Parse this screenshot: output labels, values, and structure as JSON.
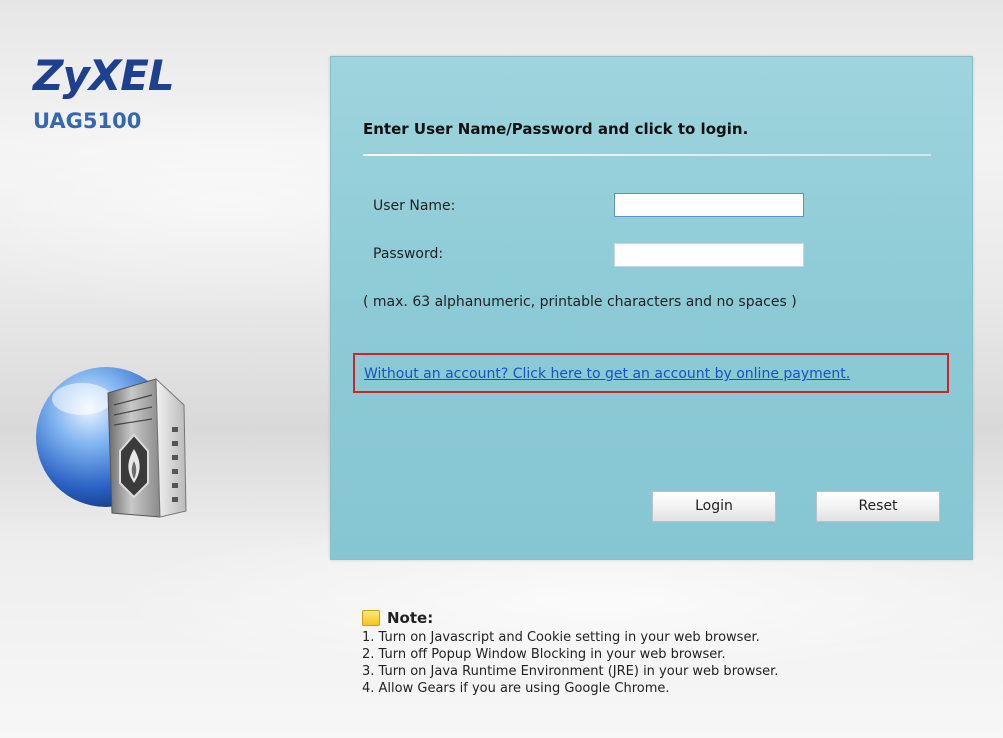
{
  "brand": {
    "logo": "ZyXEL",
    "model": "UAG5100"
  },
  "icons": {
    "product": "globe-firewall-icon",
    "note": "note-icon"
  },
  "colors": {
    "panel": "#8ccbd6",
    "brand": "#1f3f8f",
    "link": "#1a52c4",
    "highlight": "#d0242a"
  },
  "login": {
    "title": "Enter User Name/Password and click to login.",
    "username_label": "User Name:",
    "username_value": "",
    "password_label": "Password:",
    "password_value": "",
    "hint": "( max. 63 alphanumeric, printable characters and no spaces )",
    "account_link": "Without an account? Click here to get an account by online payment.",
    "login_button": "Login",
    "reset_button": "Reset"
  },
  "note": {
    "title": "Note:",
    "items": [
      "1. Turn on Javascript and Cookie setting in your web browser.",
      "2. Turn off Popup Window Blocking in your web browser.",
      "3. Turn on Java Runtime Environment (JRE) in your web browser.",
      "4. Allow Gears if you are using Google Chrome."
    ]
  }
}
